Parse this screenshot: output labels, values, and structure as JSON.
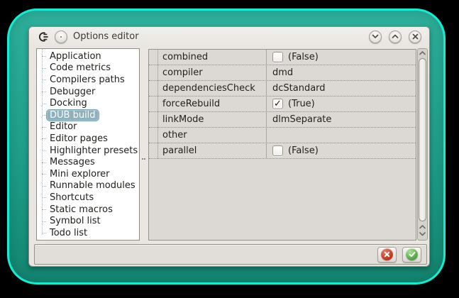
{
  "window": {
    "title": "Options editor"
  },
  "titlebar": {
    "app_icon": "coedit-logo-icon",
    "menu_button_icon": "window-menu-icon",
    "window_buttons": [
      {
        "name": "shade-button",
        "icon": "chevron-down-icon"
      },
      {
        "name": "maximize-button",
        "icon": "chevron-up-icon"
      },
      {
        "name": "close-button",
        "icon": "close-icon"
      }
    ]
  },
  "sidebar": {
    "items": [
      {
        "label": "Application",
        "selected": false
      },
      {
        "label": "Code metrics",
        "selected": false
      },
      {
        "label": "Compilers paths",
        "selected": false
      },
      {
        "label": "Debugger",
        "selected": false
      },
      {
        "label": "Docking",
        "selected": false
      },
      {
        "label": "DUB build",
        "selected": true
      },
      {
        "label": "Editor",
        "selected": false
      },
      {
        "label": "Editor pages",
        "selected": false
      },
      {
        "label": "Highlighter presets",
        "selected": false
      },
      {
        "label": "Messages",
        "selected": false
      },
      {
        "label": "Mini explorer",
        "selected": false
      },
      {
        "label": "Runnable modules",
        "selected": false
      },
      {
        "label": "Shortcuts",
        "selected": false
      },
      {
        "label": "Static macros",
        "selected": false
      },
      {
        "label": "Symbol list",
        "selected": false
      },
      {
        "label": "Todo list",
        "selected": false
      }
    ]
  },
  "properties": {
    "rows": [
      {
        "name": "combined",
        "type": "bool",
        "checked": false,
        "value": "(False)"
      },
      {
        "name": "compiler",
        "type": "text",
        "value": "dmd"
      },
      {
        "name": "dependenciesCheck",
        "type": "text",
        "value": "dcStandard"
      },
      {
        "name": "forceRebuild",
        "type": "bool",
        "checked": true,
        "value": "(True)"
      },
      {
        "name": "linkMode",
        "type": "text",
        "value": "dlmSeparate"
      },
      {
        "name": "other",
        "type": "text",
        "value": ""
      },
      {
        "name": "parallel",
        "type": "bool",
        "checked": false,
        "value": "(False)"
      }
    ]
  },
  "footer": {
    "buttons": [
      {
        "name": "cancel-button",
        "icon": "cancel-icon",
        "color": "#c23a22"
      },
      {
        "name": "accept-button",
        "icon": "accept-icon",
        "color": "#58a948"
      }
    ]
  },
  "colors": {
    "frame-teal": "#1f9f8b",
    "frame-cyan": "#12eed2",
    "window-bg": "#e9e6e1",
    "selection": "#8db1bf",
    "cancel-red": "#c23a22",
    "accept-green": "#58a948"
  }
}
